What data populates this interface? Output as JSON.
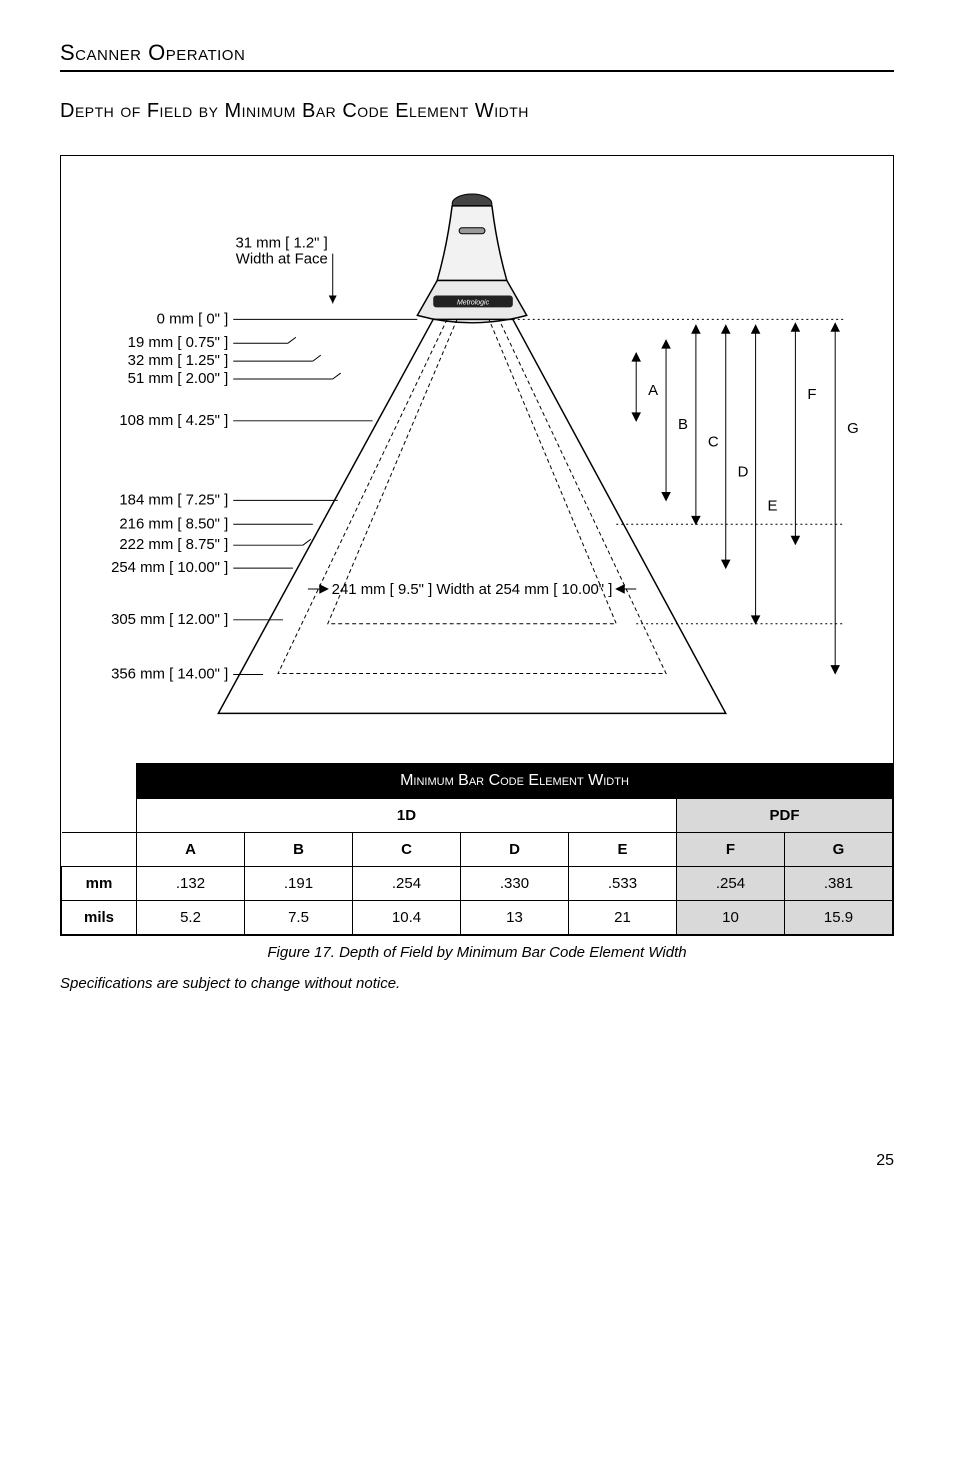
{
  "section_title": "Scanner Operation",
  "sub_title": "Depth of Field by Minimum Bar Code Element Width",
  "diagram": {
    "face_width_label_line1": "31 mm [ 1.2\" ]",
    "face_width_label_line2": "Width at Face",
    "distances": [
      "0 mm [ 0\" ]",
      "19 mm [ 0.75\" ]",
      "32 mm [ 1.25\" ]",
      "51 mm [ 2.00\" ]",
      "108 mm [ 4.25\" ]",
      "184 mm [ 7.25\" ]",
      "216 mm [ 8.50\" ]",
      "222 mm [ 8.75\" ]",
      "254 mm [ 10.00\" ]",
      "305 mm [ 12.00\" ]",
      "356 mm [ 14.00\" ]"
    ],
    "width_at_distance_label": "241 mm [ 9.5\" ] Width at 254 mm [ 10.00\" ]",
    "letters": [
      "A",
      "B",
      "C",
      "D",
      "E",
      "F",
      "G"
    ],
    "brand": "Metrologic"
  },
  "table": {
    "band_title": "Minimum Bar Code Element Width",
    "group_1d": "1D",
    "group_pdf": "PDF",
    "cols": [
      "A",
      "B",
      "C",
      "D",
      "E",
      "F",
      "G"
    ],
    "row_mm_label": "mm",
    "row_mils_label": "mils",
    "mm": [
      ".132",
      ".191",
      ".254",
      ".330",
      ".533",
      ".254",
      ".381"
    ],
    "mils": [
      "5.2",
      "7.5",
      "10.4",
      "13",
      "21",
      "10",
      "15.9"
    ]
  },
  "caption": "Figure 17.  Depth of Field by Minimum Bar Code Element Width",
  "note": "Specifications are subject to change without notice.",
  "page_number": "25"
}
